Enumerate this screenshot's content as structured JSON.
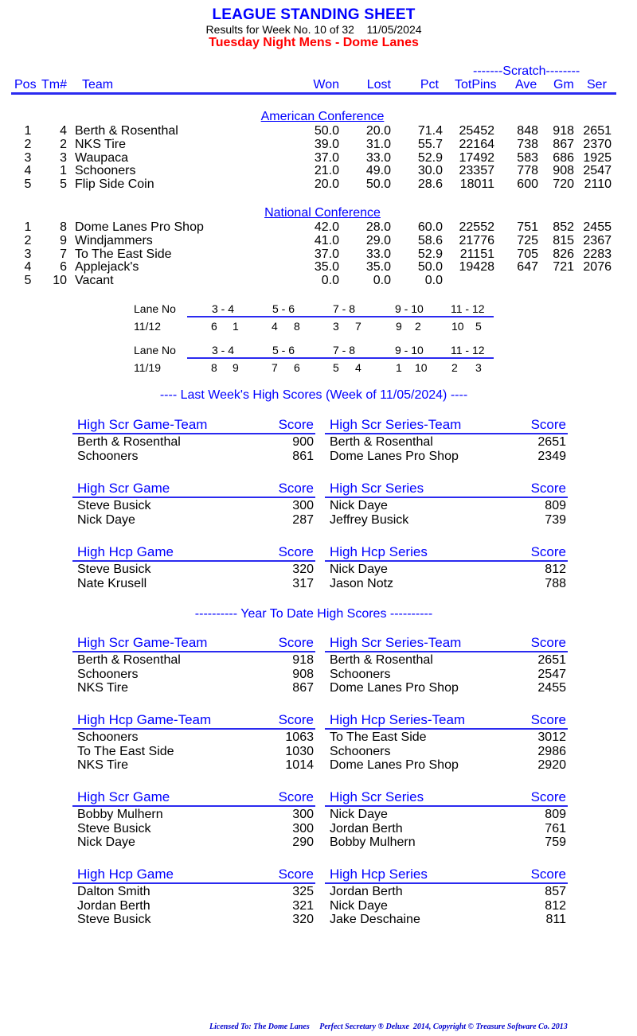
{
  "header": {
    "title": "LEAGUE STANDING SHEET",
    "subtitle": "Results for Week No. 10 of 32    11/05/2024",
    "league": "Tuesday Night Mens - Dome Lanes"
  },
  "columns": {
    "scratch_group": "-------Scratch--------",
    "pos": "Pos",
    "tm": "Tm#",
    "team": "Team",
    "won": "Won",
    "lost": "Lost",
    "pct": "Pct",
    "totpins": "TotPins",
    "ave": "Ave",
    "gm": "Gm",
    "ser": "Ser"
  },
  "conferences": [
    {
      "name": "American Conference",
      "rows": [
        {
          "pos": "1",
          "tm": "4",
          "team": "Berth & Rosenthal",
          "won": "50.0",
          "lost": "20.0",
          "pct": "71.4",
          "totpins": "25452",
          "ave": "848",
          "gm": "918",
          "ser": "2651"
        },
        {
          "pos": "2",
          "tm": "2",
          "team": "NKS Tire",
          "won": "39.0",
          "lost": "31.0",
          "pct": "55.7",
          "totpins": "22164",
          "ave": "738",
          "gm": "867",
          "ser": "2370"
        },
        {
          "pos": "3",
          "tm": "3",
          "team": "Waupaca",
          "won": "37.0",
          "lost": "33.0",
          "pct": "52.9",
          "totpins": "17492",
          "ave": "583",
          "gm": "686",
          "ser": "1925"
        },
        {
          "pos": "4",
          "tm": "1",
          "team": "Schooners",
          "won": "21.0",
          "lost": "49.0",
          "pct": "30.0",
          "totpins": "23357",
          "ave": "778",
          "gm": "908",
          "ser": "2547"
        },
        {
          "pos": "5",
          "tm": "5",
          "team": "Flip Side Coin",
          "won": "20.0",
          "lost": "50.0",
          "pct": "28.6",
          "totpins": "18011",
          "ave": "600",
          "gm": "720",
          "ser": "2110"
        }
      ]
    },
    {
      "name": "National Conference",
      "rows": [
        {
          "pos": "1",
          "tm": "8",
          "team": "Dome Lanes Pro Shop",
          "won": "42.0",
          "lost": "28.0",
          "pct": "60.0",
          "totpins": "22552",
          "ave": "751",
          "gm": "852",
          "ser": "2455"
        },
        {
          "pos": "2",
          "tm": "9",
          "team": "Windjammers",
          "won": "41.0",
          "lost": "29.0",
          "pct": "58.6",
          "totpins": "21776",
          "ave": "725",
          "gm": "815",
          "ser": "2367"
        },
        {
          "pos": "3",
          "tm": "7",
          "team": "To The East Side",
          "won": "37.0",
          "lost": "33.0",
          "pct": "52.9",
          "totpins": "21151",
          "ave": "705",
          "gm": "826",
          "ser": "2283"
        },
        {
          "pos": "4",
          "tm": "6",
          "team": "Applejack's",
          "won": "35.0",
          "lost": "35.0",
          "pct": "50.0",
          "totpins": "19428",
          "ave": "647",
          "gm": "721",
          "ser": "2076"
        },
        {
          "pos": "5",
          "tm": "10",
          "team": "Vacant",
          "won": "0.0",
          "lost": "0.0",
          "pct": "0.0",
          "totpins": "",
          "ave": "",
          "gm": "",
          "ser": ""
        }
      ]
    }
  ],
  "lane_assignments": [
    {
      "label": "Lane No",
      "date": "11/12",
      "lanes": [
        "3 - 4",
        "5 - 6",
        "7 - 8",
        "9 - 10",
        "11 - 12"
      ],
      "pairs": [
        [
          "6",
          "1"
        ],
        [
          "4",
          "8"
        ],
        [
          "3",
          "7"
        ],
        [
          "9",
          "2"
        ],
        [
          "10",
          "5"
        ]
      ]
    },
    {
      "label": "Lane No",
      "date": "11/19",
      "lanes": [
        "3 - 4",
        "5 - 6",
        "7 - 8",
        "9 - 10",
        "11 - 12"
      ],
      "pairs": [
        [
          "8",
          "9"
        ],
        [
          "7",
          "6"
        ],
        [
          "5",
          "4"
        ],
        [
          "1",
          "10"
        ],
        [
          "2",
          "3"
        ]
      ]
    }
  ],
  "last_week": {
    "heading": "----  Last Week's High Scores   (Week of 11/05/2024)  ----",
    "boxes": [
      {
        "title": "High Scr Game-Team",
        "score_label": "Score",
        "entries": [
          {
            "name": "Berth & Rosenthal",
            "score": "900"
          },
          {
            "name": "Schooners",
            "score": "861"
          }
        ]
      },
      {
        "title": "High Scr Series-Team",
        "score_label": "Score",
        "entries": [
          {
            "name": "Berth & Rosenthal",
            "score": "2651"
          },
          {
            "name": "Dome Lanes Pro Shop",
            "score": "2349"
          }
        ]
      },
      {
        "title": "High Scr Game",
        "score_label": "Score",
        "entries": [
          {
            "name": "Steve Busick",
            "score": "300"
          },
          {
            "name": "Nick Daye",
            "score": "287"
          }
        ]
      },
      {
        "title": "High Scr Series",
        "score_label": "Score",
        "entries": [
          {
            "name": "Nick Daye",
            "score": "809"
          },
          {
            "name": "Jeffrey Busick",
            "score": "739"
          }
        ]
      },
      {
        "title": "High Hcp Game",
        "score_label": "Score",
        "entries": [
          {
            "name": "Steve Busick",
            "score": "320"
          },
          {
            "name": "Nate Krusell",
            "score": "317"
          }
        ]
      },
      {
        "title": "High Hcp Series",
        "score_label": "Score",
        "entries": [
          {
            "name": "Nick Daye",
            "score": "812"
          },
          {
            "name": "Jason Notz",
            "score": "788"
          }
        ]
      }
    ]
  },
  "year_to_date": {
    "heading": "---------- Year To Date High Scores ----------",
    "boxes": [
      {
        "title": "High Scr Game-Team",
        "score_label": "Score",
        "entries": [
          {
            "name": "Berth & Rosenthal",
            "score": "918"
          },
          {
            "name": "Schooners",
            "score": "908"
          },
          {
            "name": "NKS Tire",
            "score": "867"
          }
        ]
      },
      {
        "title": "High Scr Series-Team",
        "score_label": "Score",
        "entries": [
          {
            "name": "Berth & Rosenthal",
            "score": "2651"
          },
          {
            "name": "Schooners",
            "score": "2547"
          },
          {
            "name": "Dome Lanes Pro Shop",
            "score": "2455"
          }
        ]
      },
      {
        "title": "High Hcp Game-Team",
        "score_label": "Score",
        "entries": [
          {
            "name": "Schooners",
            "score": "1063"
          },
          {
            "name": "To The East Side",
            "score": "1030"
          },
          {
            "name": "NKS Tire",
            "score": "1014"
          }
        ]
      },
      {
        "title": "High Hcp Series-Team",
        "score_label": "Score",
        "entries": [
          {
            "name": "To The East Side",
            "score": "3012"
          },
          {
            "name": "Schooners",
            "score": "2986"
          },
          {
            "name": "Dome Lanes Pro Shop",
            "score": "2920"
          }
        ]
      },
      {
        "title": "High Scr Game",
        "score_label": "Score",
        "entries": [
          {
            "name": "Bobby Mulhern",
            "score": "300"
          },
          {
            "name": "Steve Busick",
            "score": "300"
          },
          {
            "name": "Nick Daye",
            "score": "290"
          }
        ]
      },
      {
        "title": "High Scr Series",
        "score_label": "Score",
        "entries": [
          {
            "name": "Nick Daye",
            "score": "809"
          },
          {
            "name": "Jordan Berth",
            "score": "761"
          },
          {
            "name": "Bobby Mulhern",
            "score": "759"
          }
        ]
      },
      {
        "title": "High Hcp Game",
        "score_label": "Score",
        "entries": [
          {
            "name": "Dalton Smith",
            "score": "325"
          },
          {
            "name": "Jordan Berth",
            "score": "321"
          },
          {
            "name": "Steve Busick",
            "score": "320"
          }
        ]
      },
      {
        "title": "High Hcp Series",
        "score_label": "Score",
        "entries": [
          {
            "name": "Jordan Berth",
            "score": "857"
          },
          {
            "name": "Nick Daye",
            "score": "812"
          },
          {
            "name": "Jake Deschaine",
            "score": "811"
          }
        ]
      }
    ]
  },
  "footer": "Licensed To: The Dome Lanes     Perfect Secretary ® Deluxe  2014, Copyright © Treasure Software Co. 2013"
}
